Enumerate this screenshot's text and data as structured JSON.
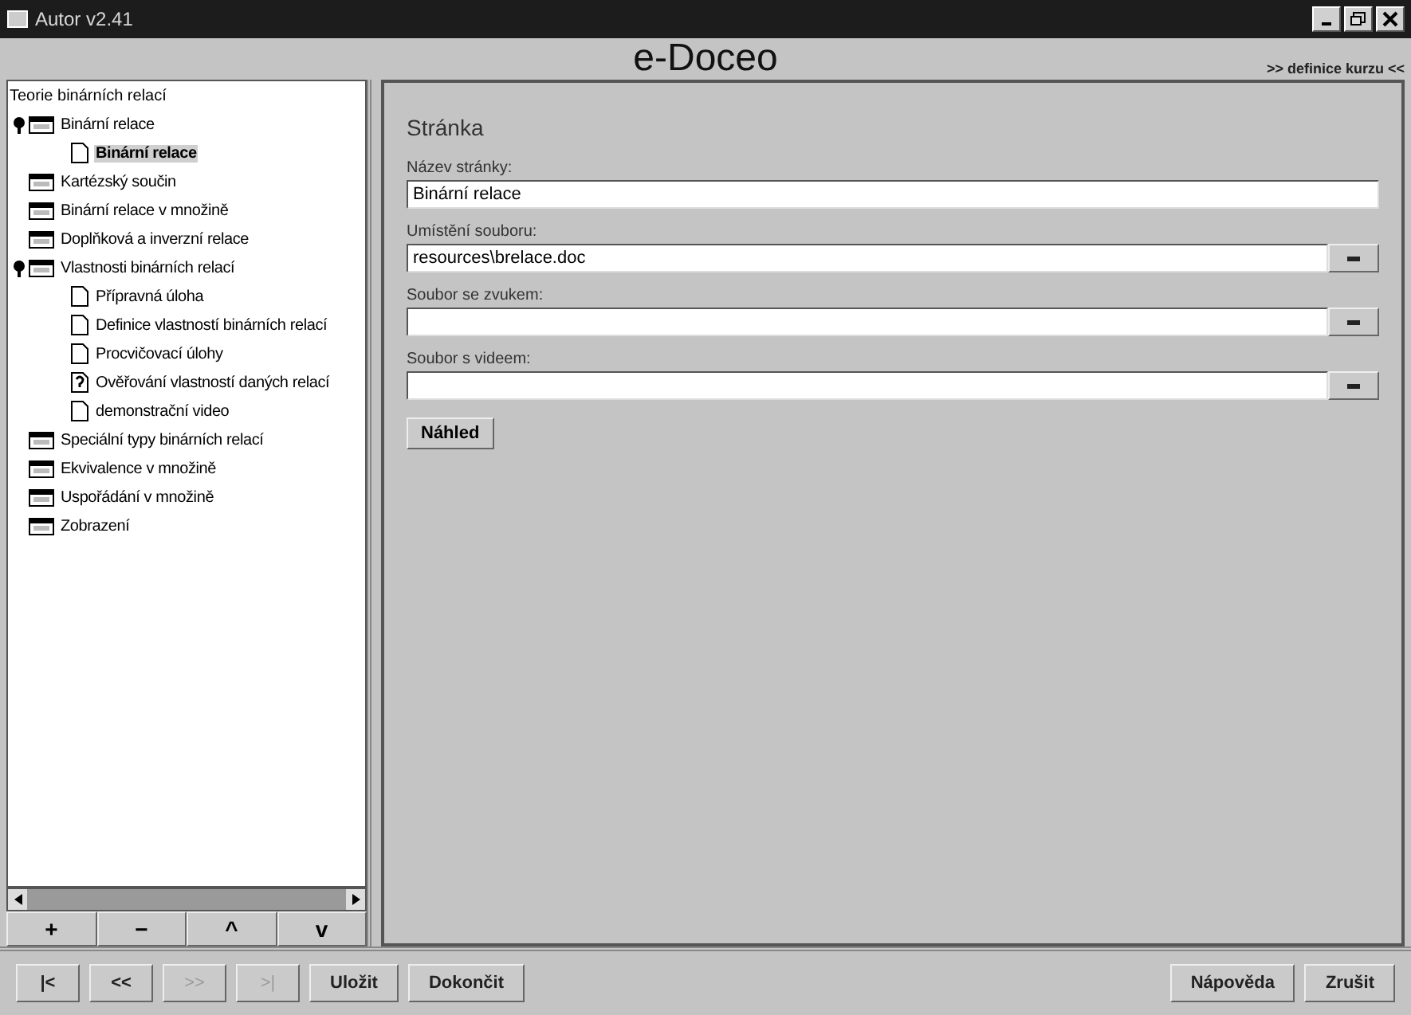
{
  "window": {
    "title": "Autor v2.41"
  },
  "header": {
    "title": "e-Doceo",
    "link": ">> definice kurzu <<"
  },
  "tree": {
    "root": "Teorie binárních relací",
    "items": [
      {
        "label": "Binární relace",
        "kind": "folder",
        "expanded": true,
        "selected": false,
        "children": [
          {
            "label": "Binární relace",
            "kind": "page",
            "selected": true
          }
        ]
      },
      {
        "label": "Kartézský součin",
        "kind": "folder",
        "selected": false
      },
      {
        "label": "Binární relace v množině",
        "kind": "folder",
        "selected": false
      },
      {
        "label": "Doplňková a inverzní relace",
        "kind": "folder",
        "selected": false
      },
      {
        "label": "Vlastnosti binárních relací",
        "kind": "folder",
        "expanded": true,
        "selected": false,
        "children": [
          {
            "label": "Přípravná úloha",
            "kind": "page",
            "selected": false
          },
          {
            "label": "Definice vlastností binárních relací",
            "kind": "page",
            "selected": false
          },
          {
            "label": "Procvičovací úlohy",
            "kind": "page",
            "selected": false
          },
          {
            "label": "Ověřování vlastností daných relací",
            "kind": "quiz",
            "selected": false
          },
          {
            "label": "demonstrační video",
            "kind": "page",
            "selected": false
          }
        ]
      },
      {
        "label": "Speciální typy binárních relací",
        "kind": "folder",
        "selected": false
      },
      {
        "label": "Ekvivalence v množině",
        "kind": "folder",
        "selected": false
      },
      {
        "label": "Uspořádání v množině",
        "kind": "folder",
        "selected": false
      },
      {
        "label": "Zobrazení",
        "kind": "folder",
        "selected": false
      }
    ]
  },
  "tree_toolbar": [
    "+",
    "−",
    "^",
    "v"
  ],
  "page": {
    "heading": "Stránka",
    "fields": [
      {
        "label": "Název stránky:",
        "value": "Binární relace",
        "kind": "text"
      },
      {
        "label": "Umístění souboru:",
        "value": "resources\\brelace.doc",
        "kind": "file"
      },
      {
        "label": "Soubor se zvukem:",
        "kind": "file"
      },
      {
        "label": "Soubor s videem:",
        "kind": "file"
      }
    ],
    "preview_button": "Náhled"
  },
  "bottom_left": [
    {
      "label": "|<",
      "disabled": false
    },
    {
      "label": "<<",
      "disabled": false
    },
    {
      "label": ">>",
      "disabled": true
    },
    {
      "label": ">|",
      "disabled": true
    },
    {
      "label": "Uložit",
      "disabled": false
    },
    {
      "label": "Dokončit",
      "disabled": false
    }
  ],
  "bottom_right": [
    {
      "label": "Nápověda",
      "disabled": false
    },
    {
      "label": "Zrušit",
      "disabled": false
    }
  ]
}
